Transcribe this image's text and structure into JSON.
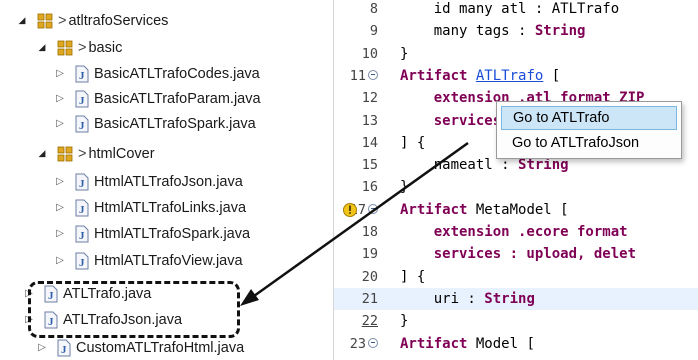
{
  "tree": {
    "root": {
      "label": "atltrafoServices"
    },
    "basic": {
      "label": "basic"
    },
    "basic_files": [
      "BasicATLTrafoCodes.java",
      "BasicATLTrafoParam.java",
      "BasicATLTrafoSpark.java"
    ],
    "htmlcover": {
      "label": "htmlCover"
    },
    "htmlcover_files": [
      "HtmlATLTrafoJson.java",
      "HtmlATLTrafoLinks.java",
      "HtmlATLTrafoSpark.java",
      "HtmlATLTrafoView.java"
    ],
    "highlighted_files": [
      "ATLTrafo.java",
      "ATLTrafoJson.java"
    ],
    "last_file": "CustomATLTrafoHtml.java"
  },
  "editor": {
    "lines": [
      {
        "num": "8",
        "parts": [
          {
            "t": "    id many atl : ATLTrafo",
            "c": "plain"
          }
        ]
      },
      {
        "num": "9",
        "parts": [
          {
            "t": "    many tags : ",
            "c": "plain"
          },
          {
            "t": "String",
            "c": "kw"
          }
        ]
      },
      {
        "num": "10",
        "parts": [
          {
            "t": "}",
            "c": "plain"
          }
        ]
      },
      {
        "num": "11",
        "parts": [
          {
            "t": "Artifact",
            "c": "kw"
          },
          {
            "t": " ",
            "c": "plain"
          },
          {
            "t": "ATLTrafo",
            "c": "link"
          },
          {
            "t": " [",
            "c": "plain"
          }
        ]
      },
      {
        "num": "12",
        "parts": [
          {
            "t": "    extension .atl format ZIP",
            "c": "kw"
          }
        ]
      },
      {
        "num": "13",
        "parts": [
          {
            "t": "    services : upload, del",
            "c": "kw"
          }
        ]
      },
      {
        "num": "14",
        "parts": [
          {
            "t": "] {",
            "c": "plain"
          }
        ]
      },
      {
        "num": "15",
        "parts": [
          {
            "t": "    nameatl : ",
            "c": "plain"
          },
          {
            "t": "String",
            "c": "kw"
          }
        ]
      },
      {
        "num": "16",
        "parts": [
          {
            "t": "}",
            "c": "plain"
          }
        ]
      },
      {
        "num": "17",
        "parts": [
          {
            "t": "Artifact",
            "c": "kw"
          },
          {
            "t": " MetaModel [",
            "c": "plain"
          }
        ]
      },
      {
        "num": "18",
        "parts": [
          {
            "t": "    extension .ecore format",
            "c": "kw"
          }
        ]
      },
      {
        "num": "19",
        "parts": [
          {
            "t": "    services : upload, delet",
            "c": "kw"
          }
        ]
      },
      {
        "num": "20",
        "parts": [
          {
            "t": "] {",
            "c": "plain"
          }
        ]
      },
      {
        "num": "21",
        "parts": [
          {
            "t": "    uri : ",
            "c": "plain"
          },
          {
            "t": "String",
            "c": "kw"
          }
        ]
      },
      {
        "num": "22",
        "parts": [
          {
            "t": "}",
            "c": "plain"
          }
        ]
      },
      {
        "num": "23",
        "parts": [
          {
            "t": "Artifact",
            "c": "kw"
          },
          {
            "t": " Model [",
            "c": "plain"
          }
        ]
      }
    ]
  },
  "popup": {
    "items": [
      "Go to ATLTrafo",
      "Go to ATLTrafoJson"
    ]
  },
  "colors": {
    "keyword": "#7f0055",
    "link": "#1a4ed8",
    "selection": "#cde6f7",
    "current_line": "#e8f2fe",
    "package_icon": "#d4a017",
    "java_icon": "#4a6fa5"
  },
  "icons": {
    "package": "package-icon",
    "java_file": "java-file-icon",
    "warning": "warning-icon",
    "fold": "fold-icon"
  }
}
